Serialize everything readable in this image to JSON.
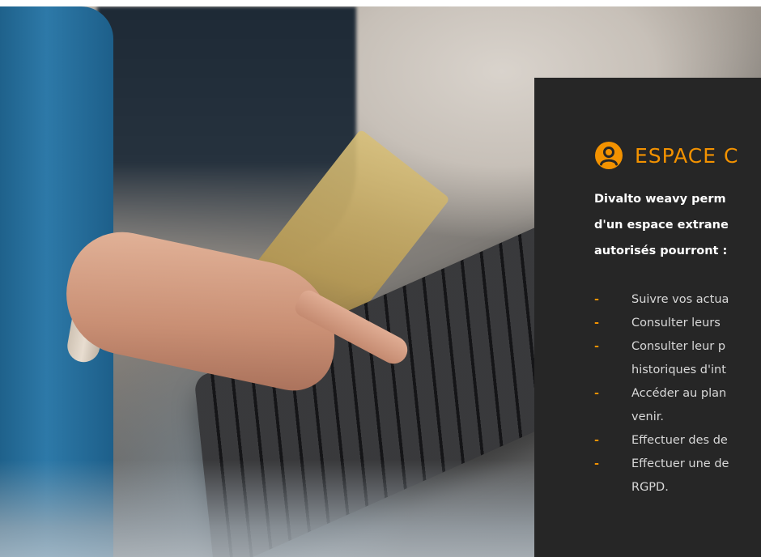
{
  "panel": {
    "accent_color": "#f39200",
    "background_color": "#262626",
    "heading_icon": "user-icon",
    "heading": "ESPACE C",
    "intro_lines": [
      "Divalto weavy perm",
      "d'un espace extrane",
      "autorisés pourront :"
    ],
    "bullets": [
      {
        "lines": [
          "Suivre vos actua"
        ]
      },
      {
        "lines": [
          "Consulter leurs"
        ]
      },
      {
        "lines": [
          "Consulter leur p",
          "historiques d'int"
        ]
      },
      {
        "lines": [
          "Accéder au plan",
          "venir."
        ]
      },
      {
        "lines": [
          "Effectuer des de"
        ]
      },
      {
        "lines": [
          "Effectuer une de",
          "RGPD."
        ]
      }
    ]
  }
}
